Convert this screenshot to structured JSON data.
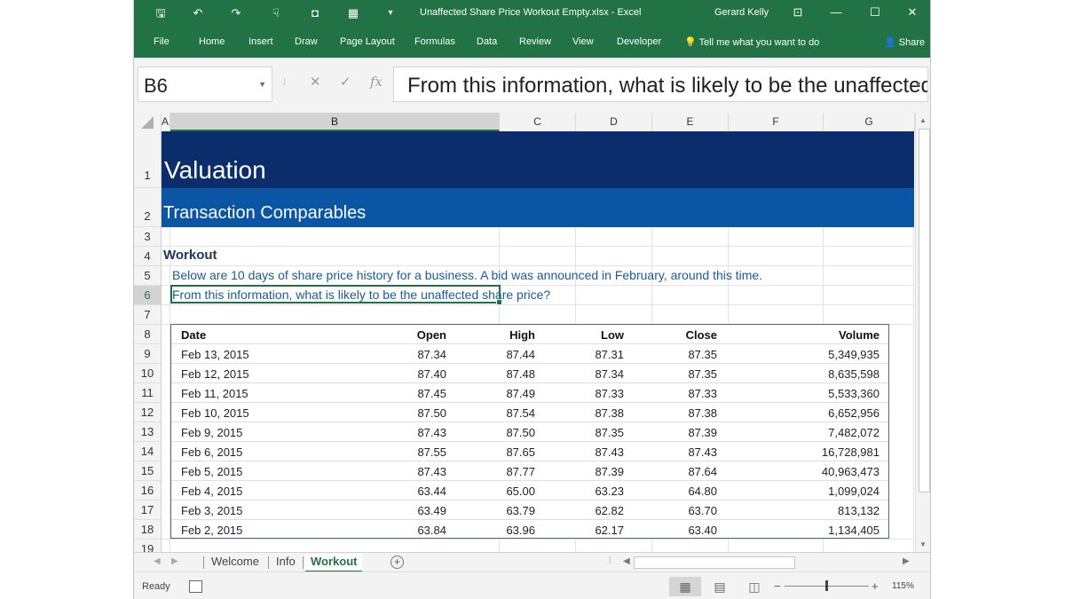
{
  "titlebar": {
    "title": "Unaffected Share Price Workout Empty.xlsx  -  Excel",
    "user": "Gerard Kelly",
    "quick_access": {
      "save": "🖫",
      "undo": "↶",
      "redo": "↷",
      "touch": "☟",
      "camera": "◘",
      "calc": "▦",
      "customize": "▾"
    },
    "controls": {
      "ribbon_display": "⊡",
      "minimize": "—",
      "maximize": "☐",
      "close": "✕"
    }
  },
  "ribbon": {
    "tabs": [
      "File",
      "Home",
      "Insert",
      "Draw",
      "Page Layout",
      "Formulas",
      "Data",
      "Review",
      "View",
      "Developer"
    ],
    "tell_me": "Tell me what you want to do",
    "share": "Share"
  },
  "formula_bar": {
    "name_box": "B6",
    "formula": "From this information, what is likely to be the unaffected share price?",
    "cancel_glyph": "✕",
    "enter_glyph": "✓",
    "fx_glyph": "fx"
  },
  "columns": [
    "A",
    "B",
    "C",
    "D",
    "E",
    "F",
    "G"
  ],
  "selected_column": "B",
  "rows": [
    "1",
    "2",
    "3",
    "4",
    "5",
    "6",
    "7",
    "8",
    "9",
    "10",
    "11",
    "12",
    "13",
    "14",
    "15",
    "16",
    "17",
    "18",
    "19"
  ],
  "selected_row": "6",
  "cells": {
    "title": "Valuation",
    "subtitle": "Transaction Comparables",
    "heading": "Workout",
    "line5": "Below are 10 days of share price history for a business. A bid was announced in February, around this time.",
    "line6": "From this information, what is likely to be the unaffected share price?"
  },
  "table": {
    "headers": [
      "Date",
      "Open",
      "High",
      "Low",
      "Close",
      "Volume"
    ],
    "rows": [
      [
        "Feb 13, 2015",
        "87.34",
        "87.44",
        "87.31",
        "87.35",
        "5,349,935"
      ],
      [
        "Feb 12, 2015",
        "87.40",
        "87.48",
        "87.34",
        "87.35",
        "8,635,598"
      ],
      [
        "Feb 11, 2015",
        "87.45",
        "87.49",
        "87.33",
        "87.33",
        "5,533,360"
      ],
      [
        "Feb 10, 2015",
        "87.50",
        "87.54",
        "87.38",
        "87.38",
        "6,652,956"
      ],
      [
        "Feb 9, 2015",
        "87.43",
        "87.50",
        "87.35",
        "87.39",
        "7,482,072"
      ],
      [
        "Feb 6, 2015",
        "87.55",
        "87.65",
        "87.43",
        "87.43",
        "16,728,981"
      ],
      [
        "Feb 5, 2015",
        "87.43",
        "87.77",
        "87.39",
        "87.64",
        "40,963,473"
      ],
      [
        "Feb 4, 2015",
        "63.44",
        "65.00",
        "63.23",
        "64.80",
        "1,099,024"
      ],
      [
        "Feb 3, 2015",
        "63.49",
        "63.79",
        "62.82",
        "63.70",
        "813,132"
      ],
      [
        "Feb 2, 2015",
        "63.84",
        "63.96",
        "62.17",
        "63.40",
        "1,134,405"
      ]
    ]
  },
  "sheet_tabs": [
    "Welcome",
    "Info",
    "Workout"
  ],
  "active_sheet": "Workout",
  "status": {
    "ready": "Ready",
    "zoom": "115%",
    "zoom_out": "−",
    "zoom_in": "+"
  },
  "colors": {
    "excel_green": "#217346",
    "title_band": "#0b2d6b",
    "subtitle_band": "#0a56a5",
    "text_blue": "#1a5a9a"
  }
}
